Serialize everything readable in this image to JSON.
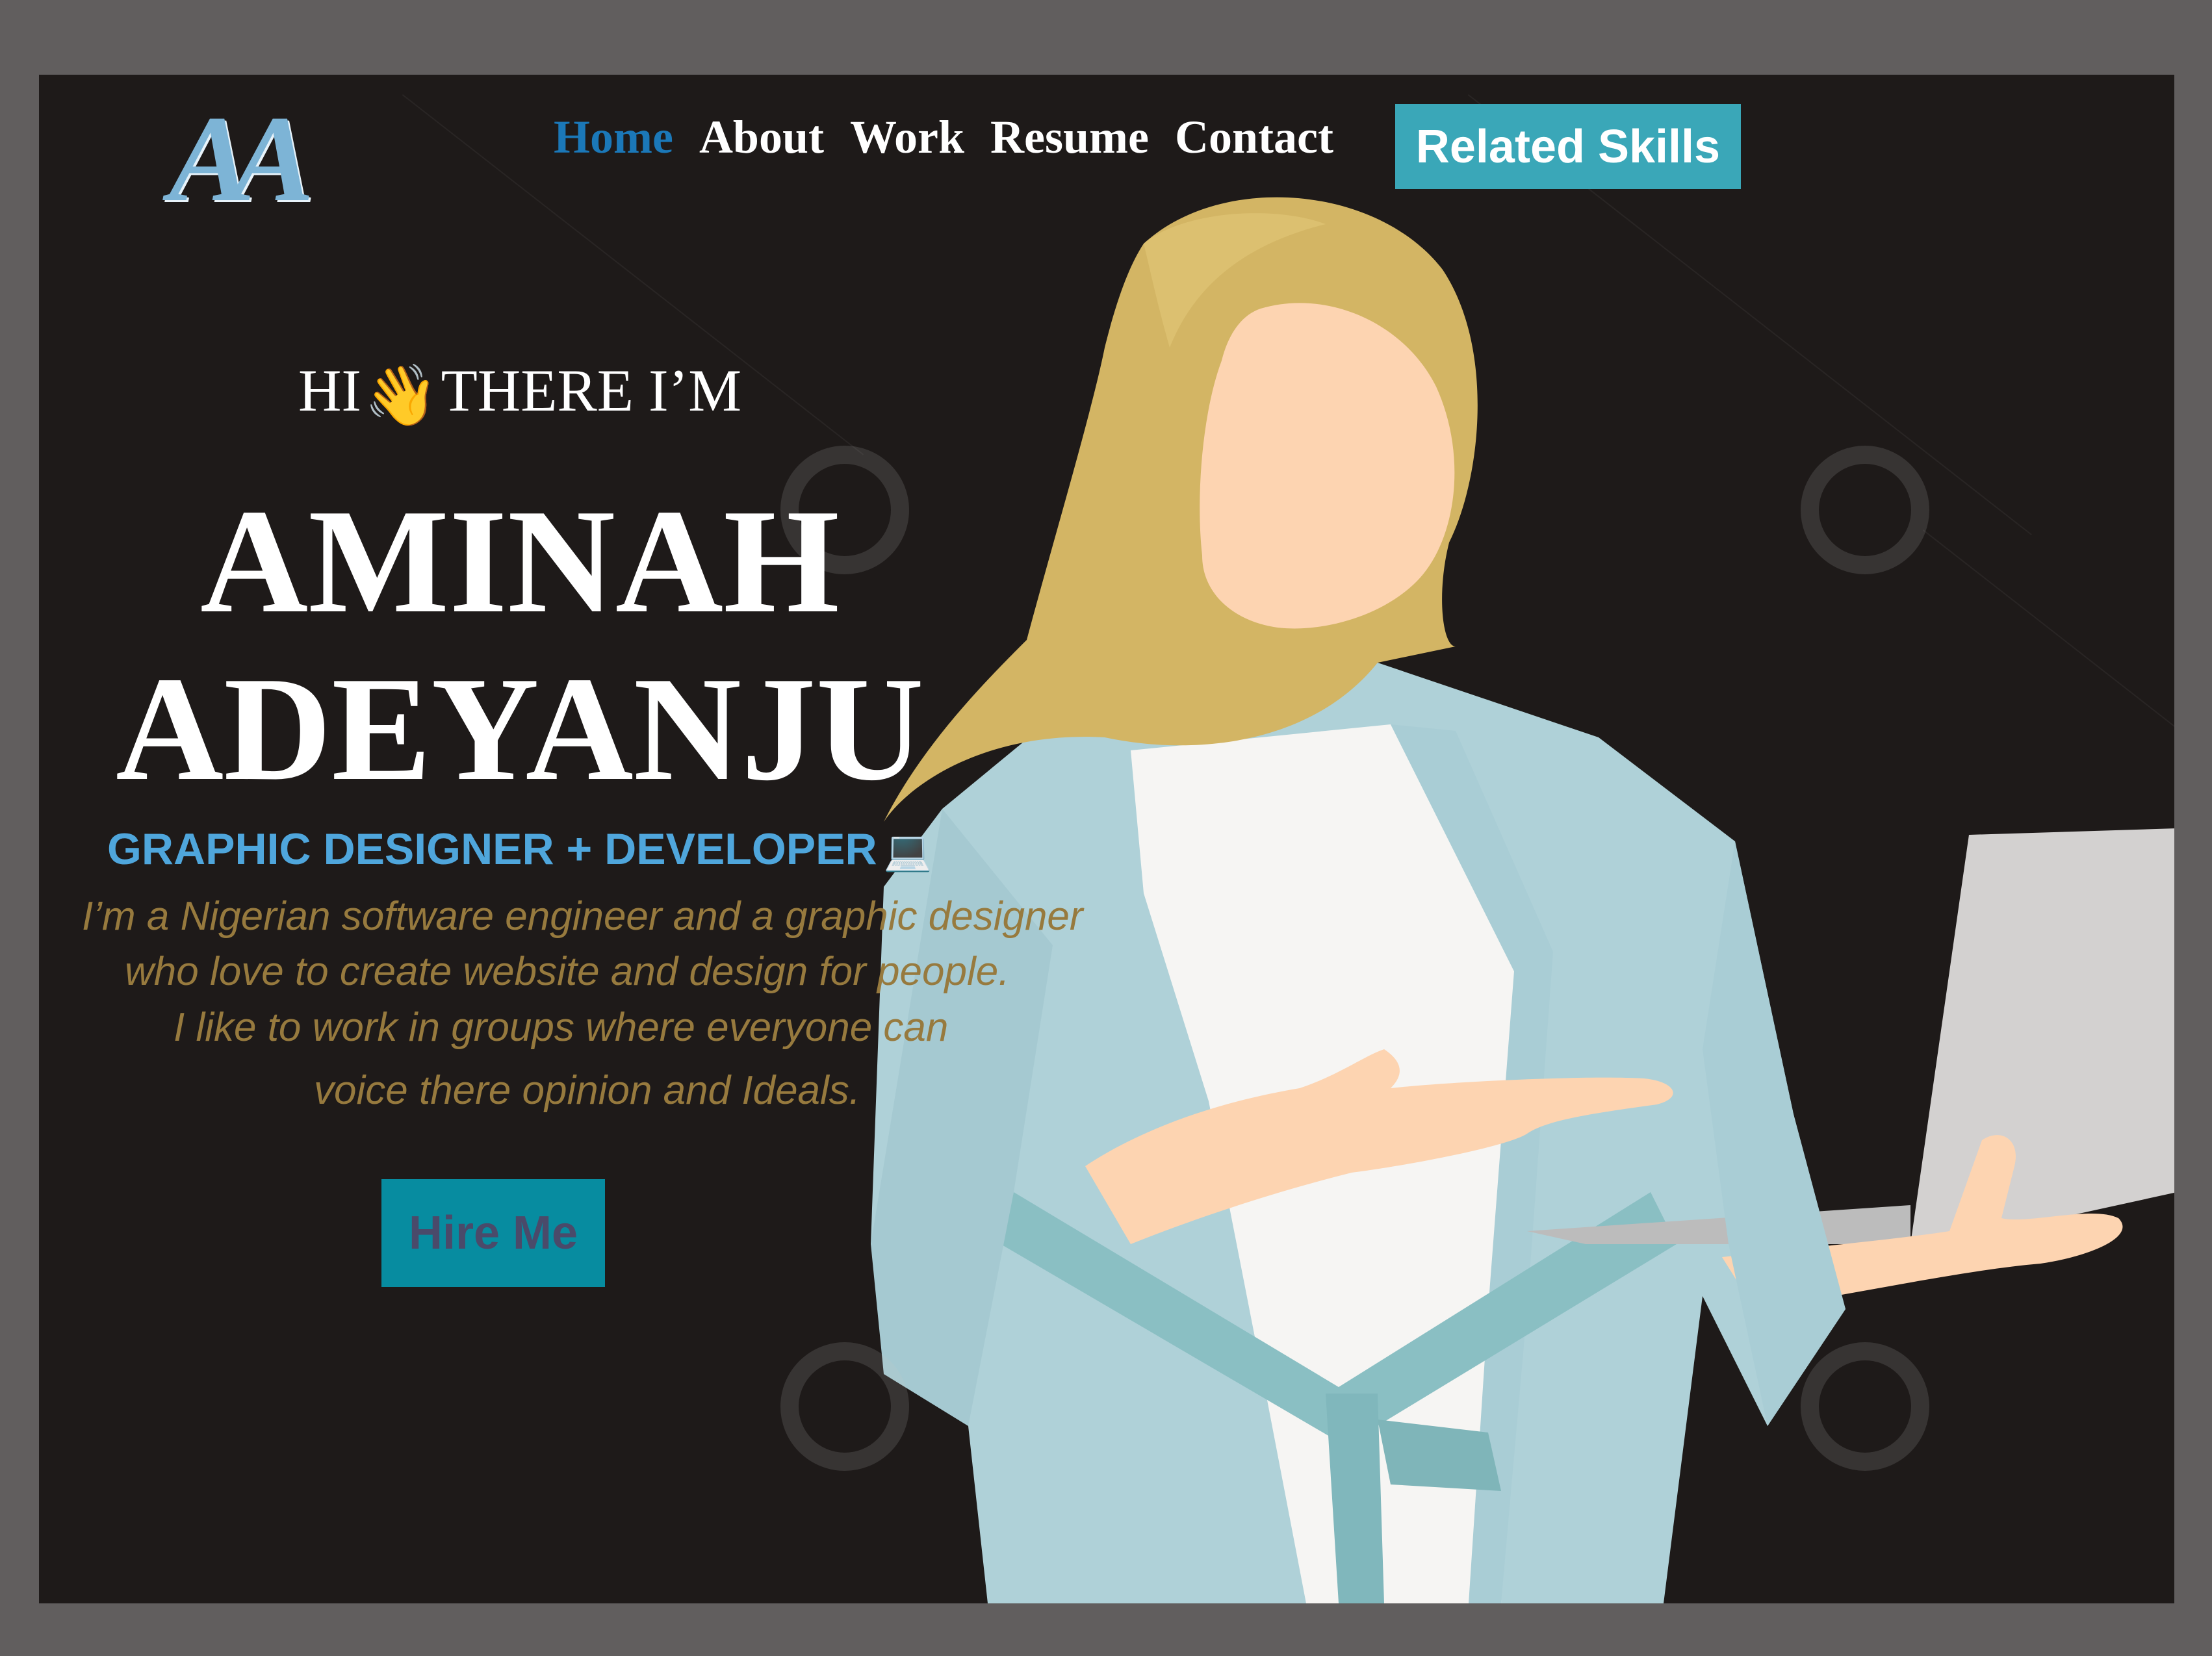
{
  "logo": {
    "text": "AA"
  },
  "nav": {
    "items": [
      {
        "label": "Home",
        "active": true
      },
      {
        "label": "About",
        "active": false
      },
      {
        "label": "Work",
        "active": false
      },
      {
        "label": "Resume",
        "active": false
      },
      {
        "label": "Contact",
        "active": false
      }
    ],
    "skills_button": "Related Skills"
  },
  "hero": {
    "greeting_before": "HI",
    "greeting_after": "THERE I’M",
    "name_line1": "AMINAH",
    "name_line2": "ADEYANJU",
    "role": "GRAPHIC DESIGNER + DEVELOPER",
    "bio": [
      "I’m a  Nigerian software engineer and a  graphic designer",
      "who love to create website and design for people.",
      "I like to work in groups where everyone can",
      "voice there opinion and Ideals."
    ],
    "hire_button": "Hire Me"
  },
  "colors": {
    "page_bg": "#615e5e",
    "hero_bg": "#1e1a19",
    "nav_active": "#1b78b8",
    "accent_button": "#3aa7b8",
    "hire_button": "#078ca0",
    "bio_text": "#977a3e",
    "role_text": "#4fa6dc"
  },
  "icons": [
    "waving-hand-icon",
    "person-at-laptop-icon"
  ],
  "illustration": "woman-in-hijab-holding-laptop"
}
